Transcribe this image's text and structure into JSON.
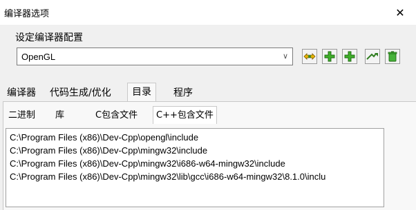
{
  "window": {
    "title": "编译器选项",
    "close_glyph": "✕"
  },
  "config": {
    "group_label": "设定编译器配置",
    "selected_profile": "OpenGL",
    "dropdown_glyph": "∨",
    "toolbar_icons": [
      "rename-profile-icon",
      "add-profile-icon",
      "add-profile-icon",
      "export-profile-icon",
      "delete-profile-icon"
    ]
  },
  "main_tabs": [
    {
      "label": "编译器",
      "active": false
    },
    {
      "label": "代码生成/优化",
      "active": false
    },
    {
      "label": "目录",
      "active": true
    },
    {
      "label": "程序",
      "active": false
    }
  ],
  "sub_tabs": [
    {
      "label": "二进制",
      "active": false
    },
    {
      "label": "库",
      "active": false
    },
    {
      "label": "C包含文件",
      "active": false
    },
    {
      "label": "C++包含文件",
      "active": true
    }
  ],
  "include_dirs": [
    "C:\\Program Files (x86)\\Dev-Cpp\\opengl\\include",
    "C:\\Program Files (x86)\\Dev-Cpp\\mingw32\\include",
    "C:\\Program Files (x86)\\Dev-Cpp\\mingw32\\i686-w64-mingw32\\include",
    "C:\\Program Files (x86)\\Dev-Cpp\\mingw32\\lib\\gcc\\i686-w64-mingw32\\8.1.0\\inclu"
  ]
}
